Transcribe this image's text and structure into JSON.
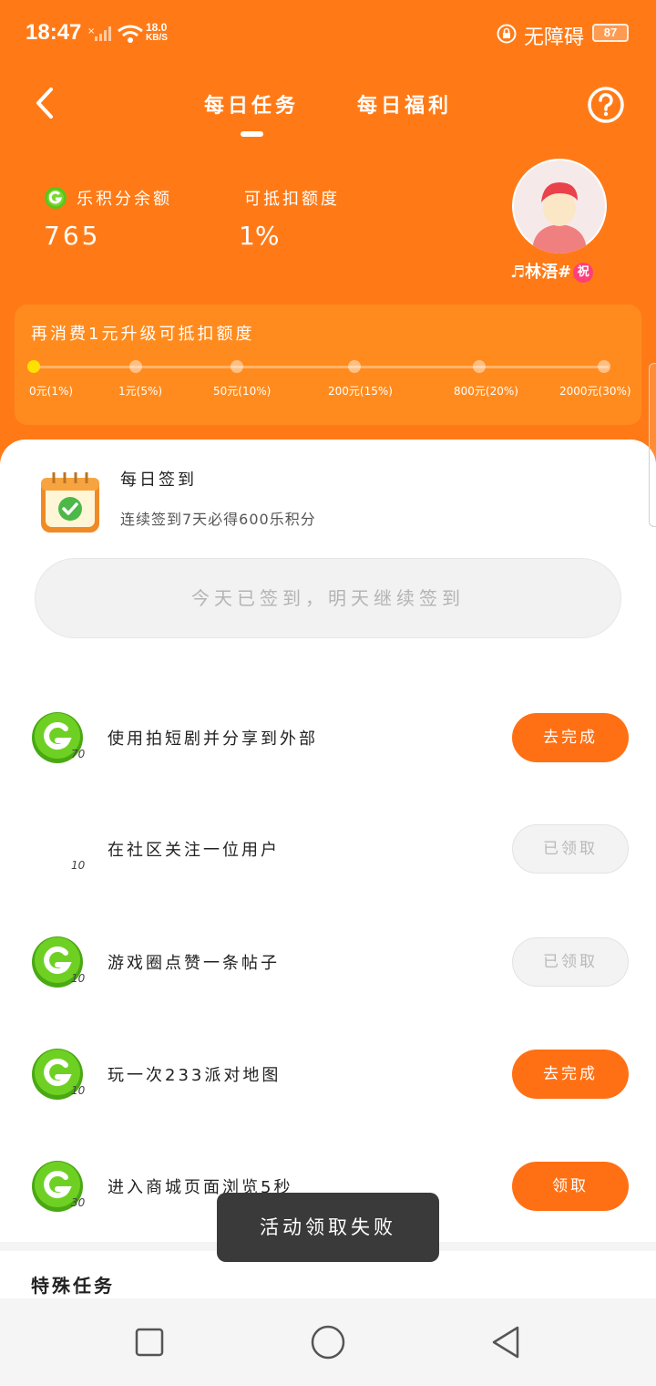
{
  "status_bar": {
    "time": "18:47",
    "net_speed_value": "18.0",
    "net_speed_unit": "KB/S",
    "accessibility": "无障碍",
    "battery": "87"
  },
  "header": {
    "tabs": [
      {
        "label": "每日任务",
        "active": true
      },
      {
        "label": "每日福利",
        "active": false
      }
    ]
  },
  "summary": {
    "points_label": "乐积分余额",
    "points_value": "765",
    "deduct_label": "可抵扣额度",
    "deduct_value": "1%",
    "username": "♬林浯#",
    "username_badge": "祝"
  },
  "level": {
    "title": "再消费1元升级可抵扣额度",
    "ticks": [
      "0元(1%)",
      "1元(5%)",
      "50元(10%)",
      "200元(15%)",
      "800元(20%)",
      "2000元(30%)"
    ],
    "current_index": 0
  },
  "signin": {
    "title": "每日签到",
    "subtitle": "连续签到7天必得600乐积分",
    "button_label": "今天已签到，明天继续签到"
  },
  "tasks": [
    {
      "text": "使用拍短剧并分享到外部",
      "reward": "70",
      "button": "去完成",
      "state": "go",
      "show_coin": true
    },
    {
      "text": "在社区关注一位用户",
      "reward": "10",
      "button": "已领取",
      "state": "done",
      "show_coin": false
    },
    {
      "text": "游戏圈点赞一条帖子",
      "reward": "10",
      "button": "已领取",
      "state": "done",
      "show_coin": true
    },
    {
      "text": "玩一次233派对地图",
      "reward": "10",
      "button": "去完成",
      "state": "go",
      "show_coin": true
    },
    {
      "text": "进入商城页面浏览5秒",
      "reward": "30",
      "button": "领取",
      "state": "go",
      "show_coin": true
    }
  ],
  "special_title": "特殊任务",
  "toast": "活动领取失败",
  "colors": {
    "brand_orange": "#ff7a16",
    "button_orange": "#ff7014",
    "coin_green": "#5cc41a",
    "progress_active": "#ffe100"
  }
}
